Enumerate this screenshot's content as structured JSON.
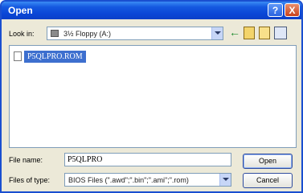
{
  "window": {
    "title": "Open"
  },
  "title_buttons": {
    "help": "?",
    "close": "X"
  },
  "look_in": {
    "label": "Look in:",
    "value": "3½ Floppy (A:)"
  },
  "toolbar": {
    "back": "←"
  },
  "files": [
    {
      "name": "P5QLPRO.ROM"
    }
  ],
  "file_name": {
    "label": "File name:",
    "value": "P5QLPRO"
  },
  "file_type": {
    "label": "Files of type:",
    "value": "BIOS Files (\".awd\";\".bin\";\".ami\";\".rom)"
  },
  "buttons": {
    "open": "Open",
    "cancel": "Cancel"
  }
}
